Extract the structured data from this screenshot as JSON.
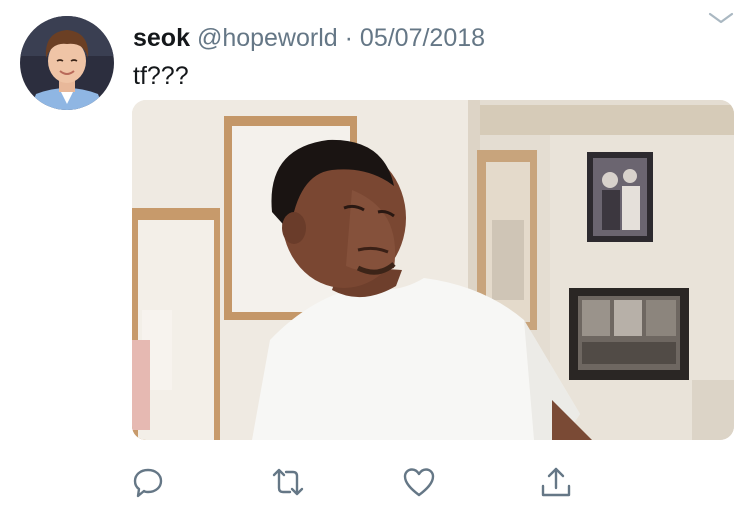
{
  "tweet": {
    "author_name": "seok",
    "author_handle": "@hopeworld",
    "separator": "·",
    "date": "05/07/2018",
    "text": "tf???"
  },
  "icons": {
    "menu": "chevron-down-icon",
    "reply": "reply-icon",
    "retweet": "retweet-icon",
    "like": "heart-icon",
    "share": "share-icon"
  },
  "colors": {
    "text_primary": "#14171a",
    "text_secondary": "#657786",
    "icon": "#657786"
  }
}
